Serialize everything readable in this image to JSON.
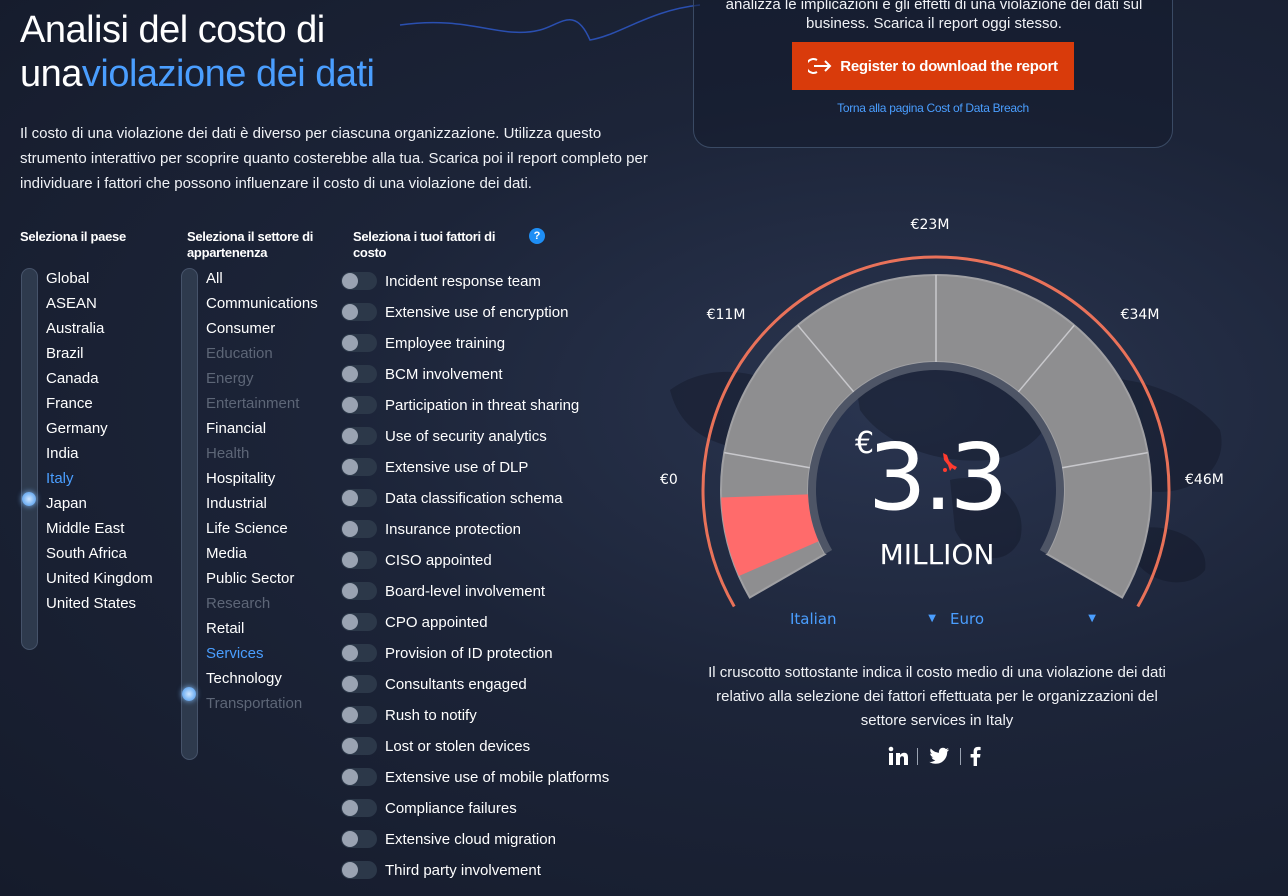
{
  "header": {
    "title_line1": "Analisi del costo di",
    "title_line2_plain": "una",
    "title_line2_highlight": "violazione dei dati",
    "intro": "Il costo di una violazione dei dati è diverso per ciascuna organizzazione. Utilizza questo strumento interattivo per scoprire quanto costerebbe alla tua. Scarica poi il report completo per individuare i fattori che possono influenzare il costo di una violazione dei dati."
  },
  "report_panel": {
    "text": "analizza le implicazioni e gli effetti di una violazione dei dati sul business. Scarica il report oggi stesso.",
    "cta_label": "Register to download the report",
    "back_link": "Torna alla pagina Cost of Data Breach"
  },
  "country": {
    "heading": "Seleziona il paese",
    "items": [
      {
        "label": "Global",
        "state": "normal"
      },
      {
        "label": "ASEAN",
        "state": "normal"
      },
      {
        "label": "Australia",
        "state": "normal"
      },
      {
        "label": "Brazil",
        "state": "normal"
      },
      {
        "label": "Canada",
        "state": "normal"
      },
      {
        "label": "France",
        "state": "normal"
      },
      {
        "label": "Germany",
        "state": "normal"
      },
      {
        "label": "India",
        "state": "normal"
      },
      {
        "label": "Italy",
        "state": "selected"
      },
      {
        "label": "Japan",
        "state": "normal"
      },
      {
        "label": "Middle East",
        "state": "normal"
      },
      {
        "label": "South Africa",
        "state": "normal"
      },
      {
        "label": "United Kingdom",
        "state": "normal"
      },
      {
        "label": "United States",
        "state": "normal"
      }
    ]
  },
  "industry": {
    "heading_line1": "Seleziona il settore di",
    "heading_line2": "appartenenza",
    "items": [
      {
        "label": "All",
        "state": "normal"
      },
      {
        "label": "Communications",
        "state": "normal"
      },
      {
        "label": "Consumer",
        "state": "normal"
      },
      {
        "label": "Education",
        "state": "disabled"
      },
      {
        "label": "Energy",
        "state": "disabled"
      },
      {
        "label": "Entertainment",
        "state": "disabled"
      },
      {
        "label": "Financial",
        "state": "normal"
      },
      {
        "label": "Health",
        "state": "disabled"
      },
      {
        "label": "Hospitality",
        "state": "normal"
      },
      {
        "label": "Industrial",
        "state": "normal"
      },
      {
        "label": "Life Science",
        "state": "normal"
      },
      {
        "label": "Media",
        "state": "normal"
      },
      {
        "label": "Public Sector",
        "state": "normal"
      },
      {
        "label": "Research",
        "state": "disabled"
      },
      {
        "label": "Retail",
        "state": "normal"
      },
      {
        "label": "Services",
        "state": "selected"
      },
      {
        "label": "Technology",
        "state": "normal"
      },
      {
        "label": "Transportation",
        "state": "disabled"
      }
    ]
  },
  "factors": {
    "heading_line1": "Seleziona i tuoi fattori di",
    "heading_line2": "costo",
    "help_glyph": "?",
    "items": [
      "Incident response team",
      "Extensive use of encryption",
      "Employee training",
      "BCM involvement",
      "Participation in threat sharing",
      "Use of security analytics",
      "Extensive use of DLP",
      "Data classification schema",
      "Insurance protection",
      "CISO appointed",
      "Board-level involvement",
      "CPO appointed",
      "Provision of ID protection",
      "Consultants engaged",
      "Rush to notify",
      "Lost or stolen devices",
      "Extensive use of mobile platforms",
      "Compliance failures",
      "Extensive cloud migration",
      "Third party involvement"
    ]
  },
  "gauge": {
    "min_label": "€0",
    "max_label": "€46M",
    "tick_labels": [
      "€11M",
      "€23M",
      "€34M"
    ],
    "max_value": 46,
    "value": 3.3,
    "currency_symbol": "€",
    "value_text": "3.3",
    "unit_text": "MILLION",
    "fill_color": "#ff6b6b",
    "track_color": "#8e8e90",
    "arc_glow_color": "#ff7a5c"
  },
  "selectors": {
    "language": "Italian",
    "currency": "Euro"
  },
  "caption": "Il cruscotto sottostante indica il costo medio di una violazione dei dati relativo alla selezione dei fattori effettuata per le organizzazioni del settore services in Italy",
  "social_icons": [
    "linkedin-icon",
    "twitter-icon",
    "facebook-icon"
  ]
}
